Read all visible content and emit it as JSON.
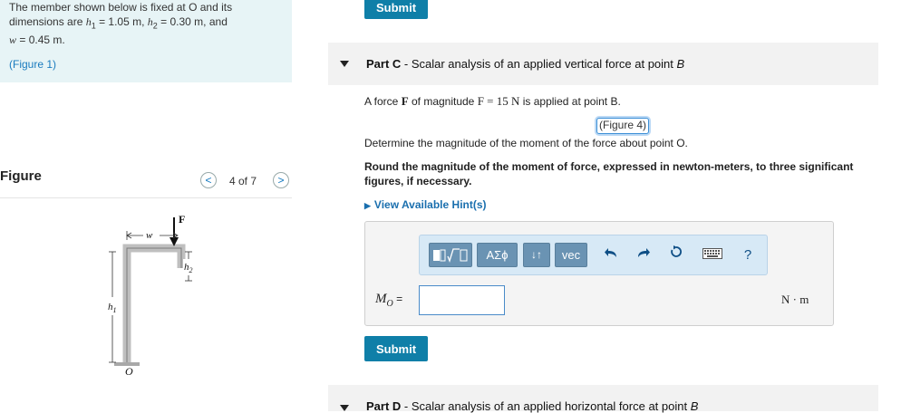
{
  "problem": {
    "line1": "The member shown below is fixed at O and its",
    "line2_prefix": "dimensions are ",
    "h1_sym": "h",
    "h1_sub": "1",
    "h1_val": " = 1.05 m",
    "sep1": ", ",
    "h2_sym": "h",
    "h2_sub": "2",
    "h2_val": " = 0.30 m",
    "sep2": ", and",
    "w_sym": "w",
    "w_val": " = 0.45 m.",
    "figure_link": "(Figure 1)"
  },
  "figure_panel": {
    "title": "Figure",
    "count": "4 of 7",
    "prev_glyph": "<",
    "next_glyph": ">",
    "label_F": "F",
    "label_w": "w",
    "label_h1": "h",
    "label_h1_sub": "1",
    "label_h2": "h",
    "label_h2_sub": "2",
    "label_O": "O"
  },
  "top_submit": "Submit",
  "part_c": {
    "prefix": "Part C",
    "title": " - Scalar analysis of an applied vertical force at point ",
    "point": "B",
    "statement_pre": "A force ",
    "force_sym": "F",
    "statement_mid": " of magnitude ",
    "magnitude": "F = 15 N",
    "statement_post": " is applied at point B.",
    "figure_link": "(Figure 4)",
    "question": "Determine the magnitude of the moment of the force about point O.",
    "instruction": "Round the magnitude of the moment of force, expressed in newton-meters, to three significant figures, if necessary.",
    "hints": "View Available Hint(s)",
    "toolbar": {
      "greek": "ΑΣϕ",
      "arrows": "↓↑",
      "vec": "vec",
      "help": "?"
    },
    "answer_label": "M",
    "answer_sub": "O",
    "answer_eq": " =",
    "answer_value": "",
    "unit": "N · m",
    "submit": "Submit"
  },
  "part_d": {
    "prefix": "Part D",
    "title": " - Scalar analysis of an applied horizontal force at point ",
    "point": "B"
  },
  "colors": {
    "accent": "#0f7fa8",
    "info_panel": "#e7f4f6",
    "toolbar": "#d7e9f6",
    "link": "#1a7bbf"
  }
}
